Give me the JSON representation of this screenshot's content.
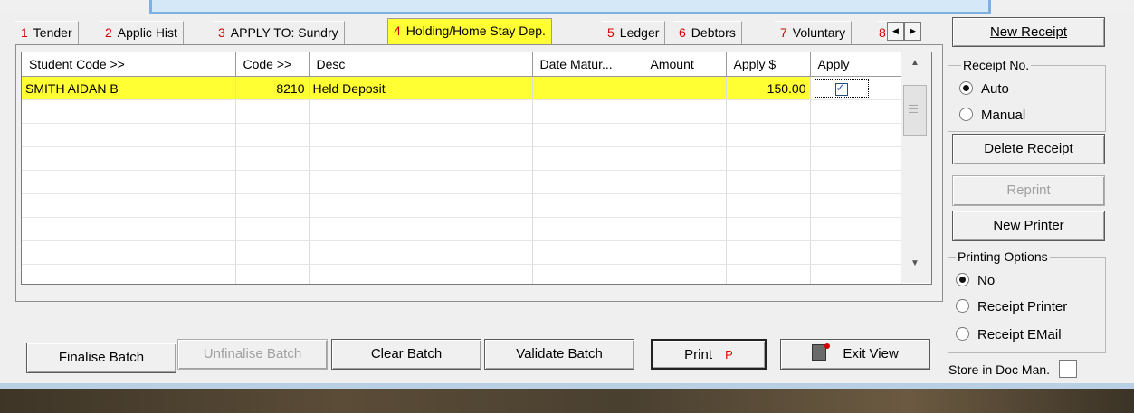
{
  "tabs": [
    {
      "num": "1",
      "label": "Tender"
    },
    {
      "num": "2",
      "label": "Applic Hist"
    },
    {
      "num": "3",
      "label": "APPLY TO: Sundry"
    },
    {
      "num": "4",
      "label": "Holding/Home Stay Dep."
    },
    {
      "num": "5",
      "label": "Ledger"
    },
    {
      "num": "6",
      "label": "Debtors"
    },
    {
      "num": "7",
      "label": "Voluntary"
    },
    {
      "num": "8",
      "label": ""
    }
  ],
  "grid": {
    "headers": [
      "Student Code >>",
      "Code >>",
      "Desc",
      "Date Matur...",
      "Amount",
      "Apply $",
      "Apply"
    ],
    "rows": [
      {
        "student": "SMITH AIDAN B",
        "code": "8210",
        "desc": "Held Deposit",
        "date": "",
        "amount": "",
        "apply_amt": "150.00",
        "apply": true
      }
    ]
  },
  "bottom_buttons": {
    "finalise": "Finalise Batch",
    "unfinalise": "Unfinalise Batch",
    "clear": "Clear Batch",
    "validate": "Validate Batch",
    "print": "Print",
    "print_hotkey": "P",
    "exit": "Exit View"
  },
  "side": {
    "new_receipt": "New Receipt",
    "receipt_no_legend": "Receipt No.",
    "receipt_auto": "Auto",
    "receipt_manual": "Manual",
    "delete_receipt": "Delete Receipt",
    "reprint": "Reprint",
    "new_printer": "New Printer",
    "printing_legend": "Printing Options",
    "print_no": "No",
    "print_receipt_printer": "Receipt Printer",
    "print_receipt_email": "Receipt EMail",
    "store_doc": "Store in Doc Man."
  },
  "colors": {
    "selection": "#ffff33",
    "tab_number": "#d00000"
  }
}
